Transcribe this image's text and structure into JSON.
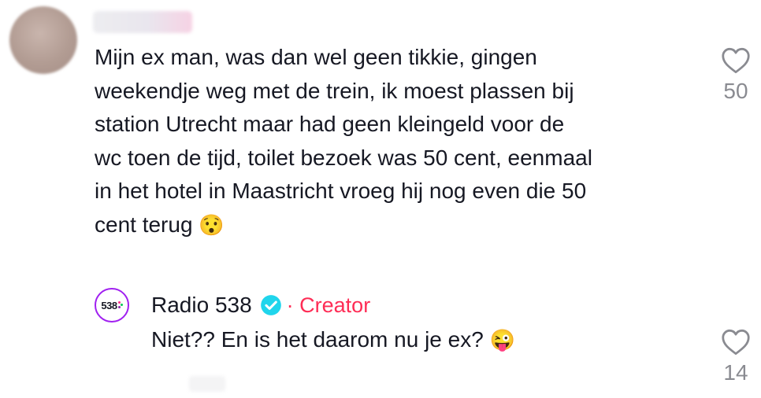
{
  "comment": {
    "text": "Mijn ex man, was dan wel geen tikkie, gingen\nweekendje weg met de trein, ik moest plassen bij\nstation Utrecht maar had geen kleingeld voor de\nwc toen de tijd, toilet bezoek was 50 cent, eenmaal\nin het hotel in Maastricht vroeg hij nog even die 50\ncent terug ",
    "emoji": "😯",
    "like_count": "50"
  },
  "reply": {
    "avatar_text": "538",
    "author": "Radio 538",
    "verified_icon": "verified-check-icon",
    "badge": "· Creator",
    "text": "Niet?? En is het daarom nu je ex? ",
    "emoji": "😜",
    "like_count": "14"
  },
  "colors": {
    "text": "#161823",
    "muted": "#8a8b91",
    "creator": "#fe2c55",
    "verified": "#20d5ec",
    "avatar_ring": "#a020f0"
  }
}
